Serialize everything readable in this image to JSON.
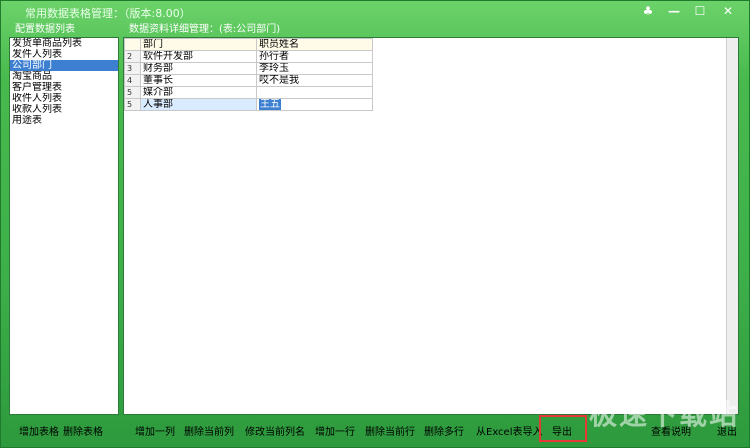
{
  "window": {
    "title": "常用数据表格管理：（版本:8.00）",
    "controls": {
      "pin": "♣",
      "minimize": "—",
      "maximize": "☐",
      "close": "✕"
    }
  },
  "left_panel": {
    "header": "配置数据列表",
    "items": [
      {
        "label": "发货单商品列表",
        "selected": false
      },
      {
        "label": "发件人列表",
        "selected": false
      },
      {
        "label": "公司部门",
        "selected": true
      },
      {
        "label": "淘宝商品",
        "selected": false
      },
      {
        "label": "客户管理表",
        "selected": false
      },
      {
        "label": "收件人列表",
        "selected": false
      },
      {
        "label": "收款人列表",
        "selected": false
      },
      {
        "label": "用途表",
        "selected": false
      }
    ]
  },
  "right_panel": {
    "header": "数据资料详细管理：(表:公司部门)",
    "columns": [
      "部门",
      "职员姓名"
    ],
    "rows": [
      {
        "num": "2",
        "cells": [
          "软件开发部",
          "孙行者"
        ]
      },
      {
        "num": "3",
        "cells": [
          "财务部",
          "李玲玉"
        ]
      },
      {
        "num": "4",
        "cells": [
          "董事长",
          "哎不是我"
        ]
      },
      {
        "num": "5",
        "cells": [
          "媒介部",
          ""
        ]
      },
      {
        "num": "5",
        "cells": [
          "人事部",
          "王五"
        ]
      }
    ]
  },
  "bottom": {
    "add_table": "增加表格",
    "delete_table": "删除表格",
    "add_column": "增加一列",
    "delete_column": "删除当前列",
    "rename_column": "修改当前列名",
    "add_row": "增加一行",
    "delete_row": "删除当前行",
    "delete_multi": "删除多行",
    "import_excel": "从Excel表导入",
    "export": "导出",
    "view_help": "查看说明",
    "exit": "退出"
  },
  "watermark": "极速下载站",
  "colors": {
    "accent": "#3d7fd1",
    "window_green": "#3eb04a",
    "highlight": "#e53935"
  }
}
